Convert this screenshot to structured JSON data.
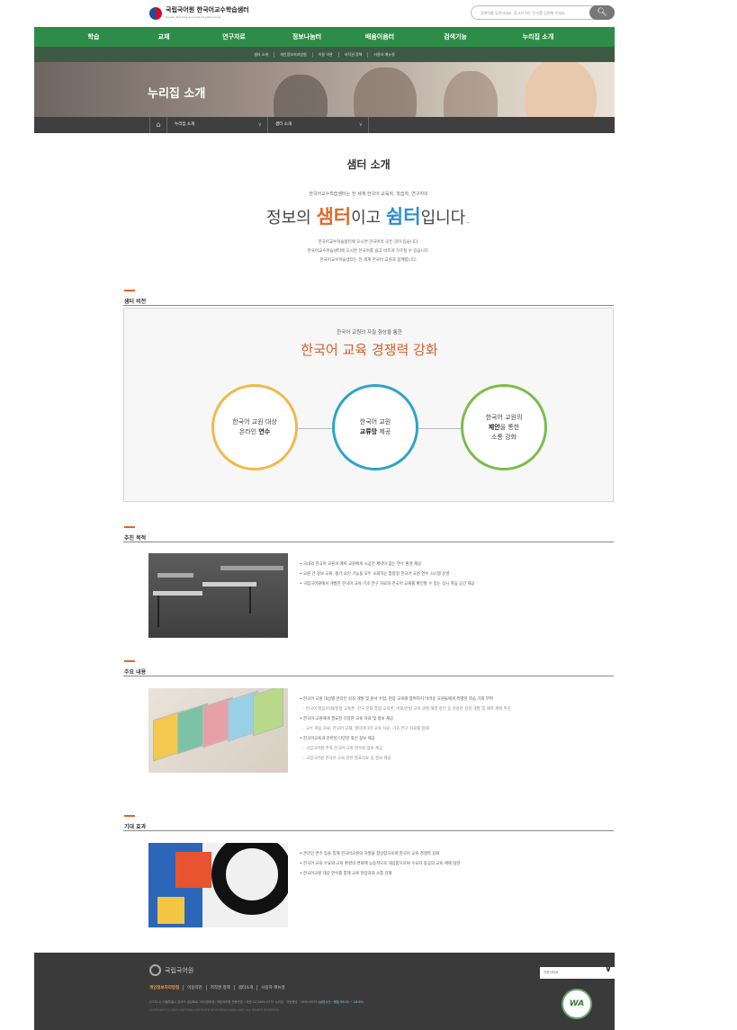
{
  "header": {
    "logo_text": "국립국어원 한국어교수학습샘터",
    "logo_sub": "Korean Teaching and Learning Resources",
    "search_placeholder": "검색어를 입력하세요. 찾고자 하는 단어를 입력해 주세요.",
    "search_icon": "magnifier"
  },
  "gnb": [
    "학습",
    "교재",
    "연구자료",
    "정보나눔터",
    "배움이음터",
    "검색기능",
    "누리집 소개"
  ],
  "subnav": [
    "샘터 소개",
    "개인정보처리방침",
    "이용 약관",
    "저작권 정책",
    "사용자 매뉴얼"
  ],
  "hero": {
    "title": "누리집 소개"
  },
  "location": {
    "home_icon": "home",
    "seg1": "누리집 소개",
    "seg2": "샘터 소개"
  },
  "intro": {
    "title": "샘터 소개",
    "line1": "한국어교수학습샘터는 전 세계 한국어 교육자, 학습자, 연구자의",
    "line2_a": "정보의 ",
    "line2_b": "샘터",
    "line2_c": "이고 ",
    "line2_d": "쉼터",
    "line2_e": "입니다.",
    "p1": "한국어교수학습샘터에 오시면 한국어의 모든 것이 있습니다.",
    "p2": "한국어교수학습샘터에 오시면 한국어를 쉽고 바르게 가르칠 수 있습니다.",
    "p3": "한국어교수학습샘터는 전 세계 한국어 교원과 함께합니다."
  },
  "vision": {
    "heading": "샘터 비전",
    "sub": "한국어 교원의 자질 향상을 통한",
    "main": "한국어 교육 경쟁력 강화",
    "c1_a": "한국어 교원 대상",
    "c1_b": "온라인 ",
    "c1_c": "연수",
    "c2_a": "한국어 교원",
    "c2_b": "교류망",
    "c2_c": " 제공",
    "c3_a": "한국어 교원의",
    "c3_b": "제안",
    "c3_c": "을 통한",
    "c3_d": "소통 강화"
  },
  "purpose": {
    "heading": "추진 목적",
    "items": [
      "국내외 한국어 교원과 예비 교원에게 시공간 제약이 없는 연수 환경 제공",
      "교원 간 정보 교류, 평가 요인 기능을 모두 소화하는 통합형 한국어 교원 연수 시스템 운영",
      "국립국어원에서 개발한 한국어 교육 기초 연구 자료와 한국어 교재를 확인할 수 있는 상시 학습 공간 제공"
    ]
  },
  "contents": {
    "heading": "주요 내용",
    "i1": "한국어 교원 대상별 온라인 강좌 개발 및 원서 수업, 현장 교육에 참여하지 어려운 교원들에게 특별한 학습 기회 부여",
    "s1": "한국어 발음/어휘/문법 교육론, 한국 문화 통합 교육론, 어휘/문법 교육 과제 해결 방안 등 유용한 강의 개발 및 제작 계획 추진",
    "i2": "한국어 교원에게 필요한 다양한 교육 자료 및 정보 제공",
    "s2": "교수 학습 자료, 한국어 교재, 멀티미디어 교육 자료, 기초 연구 자료를 탑재",
    "i3": "한국어교육과 관련된 다양한 최신 정보 제공",
    "s3a": "국립국어원 주최 한국어 교원 연수회 정보 제공",
    "s3b": "국립국어원 한국어 교육 관련 발표자료 등 정보 제공"
  },
  "effects": {
    "heading": "기대 효과",
    "items": [
      "온라인 연수 등을 통해 한국어교원의 자질을 향상함으로써 한국어 교육 경쟁력 강화",
      "한국어 교육 수요와 교육 환경의 변화에 능동적으로 대응함으로써 수요자 중심의 교육 체제 실현",
      "한국어교원 대상 연수를 통해 교육 현장과의 소통 강화"
    ]
  },
  "footer": {
    "logo": "국립국어원",
    "links": [
      "개인정보처리방침",
      "이용약관",
      "저작권 정책",
      "샘터소개",
      "사용자 매뉴얼"
    ],
    "addr": "(07511) 서울특별시 강서구 금낭화로 154(방화동) 국립국어원   전화번호 : 대표 02-2669-9775   누리집 · 자동응답 : 1599-9979",
    "hours": " (상담시간 : 평일 09:00 ~ 18:00)",
    "copyright": "COPYRIGHT(C) 2019 NATIONAL INSTITUTE OF KOREAN LANGUAGE. ALL RIGHTS RESERVED.",
    "select_label": "관련사이트",
    "badge": "WA"
  }
}
